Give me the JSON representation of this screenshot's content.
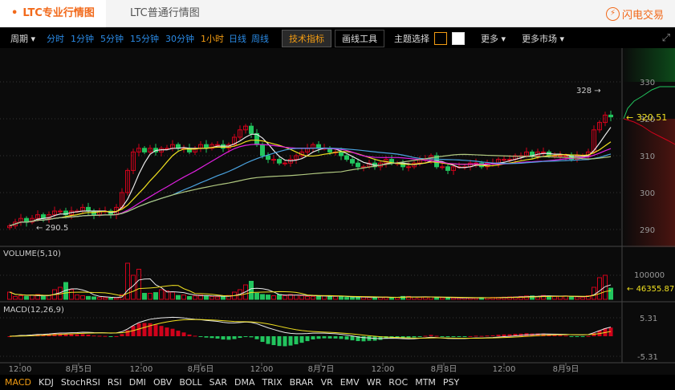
{
  "tabs": {
    "active": "LTC专业行情图",
    "inactive": "LTC普通行情图",
    "trade": "闪电交易",
    "trade_icon": "lightning-icon"
  },
  "toolbar": {
    "period": "周期",
    "intervals": [
      "分时",
      "1分钟",
      "5分钟",
      "15分钟",
      "30分钟",
      "1小时",
      "日线",
      "周线"
    ],
    "active_interval": "1小时",
    "tech": "技术指标",
    "draw": "画线工具",
    "theme": "主题选择",
    "more": "更多",
    "more_markets": "更多市场"
  },
  "colors": {
    "up": "#d0021b",
    "down": "#22c55e",
    "accent": "#f39c12",
    "ma": [
      "#e8e8e8",
      "#f0e020",
      "#e020e0",
      "#4aa3e0",
      "#b0c880"
    ]
  },
  "indicators": [
    "MACD",
    "KDJ",
    "StochRSI",
    "RSI",
    "DMI",
    "OBV",
    "BOLL",
    "SAR",
    "DMA",
    "TRIX",
    "BRAR",
    "VR",
    "EMV",
    "WR",
    "ROC",
    "MTM",
    "PSY"
  ],
  "active_indicator": "MACD",
  "chart_data": {
    "type": "candlestick",
    "price_axis": {
      "ticks": [
        "330",
        "320",
        "310",
        "300",
        "290"
      ],
      "range": [
        285,
        336
      ]
    },
    "last_price": "320.51",
    "high_label": "328",
    "low_label": "290.5",
    "closes": [
      291,
      292,
      293,
      292,
      293,
      294,
      293,
      294,
      295,
      295,
      294,
      295,
      295,
      296,
      295,
      294,
      295,
      295,
      294,
      296,
      300,
      306,
      311,
      312,
      311,
      312,
      311,
      312,
      312,
      313,
      312,
      312,
      311,
      312,
      313,
      312,
      313,
      313,
      312,
      313,
      315,
      317,
      318,
      316,
      313,
      310,
      309,
      309,
      308,
      308,
      309,
      310,
      311,
      312,
      313,
      312,
      312,
      311,
      311,
      310,
      309,
      308,
      307,
      307,
      308,
      307,
      308,
      309,
      308,
      308,
      307,
      307,
      308,
      309,
      309,
      310,
      307,
      307,
      306,
      307,
      307,
      307,
      308,
      308,
      307,
      308,
      308,
      309,
      309,
      309,
      310,
      310,
      311,
      310,
      311,
      311,
      310,
      310,
      310,
      310,
      309,
      310,
      310,
      311,
      317,
      319,
      321,
      320.51
    ],
    "volume": {
      "label": "VOLUME(5,10)",
      "tick": "100000",
      "last": "46355.87",
      "values": [
        30000,
        12000,
        15000,
        12000,
        18000,
        20000,
        12000,
        16000,
        40000,
        50000,
        70000,
        40000,
        18000,
        15000,
        12000,
        10000,
        8000,
        7000,
        6000,
        6000,
        20000,
        150000,
        100000,
        125000,
        25000,
        25000,
        28000,
        40000,
        35000,
        30000,
        16000,
        18000,
        12000,
        14000,
        18000,
        15000,
        12000,
        10000,
        10000,
        16000,
        30000,
        40000,
        60000,
        75000,
        25000,
        20000,
        18000,
        15000,
        20000,
        15000,
        20000,
        18000,
        15000,
        12000,
        12000,
        14000,
        15000,
        13000,
        12000,
        12000,
        8000,
        8000,
        10000,
        9000,
        8000,
        8000,
        8000,
        10000,
        8000,
        8000,
        12000,
        12000,
        10000,
        9000,
        9000,
        10000,
        8000,
        7000,
        6000,
        6000,
        6000,
        7000,
        6000,
        6000,
        7000,
        7000,
        8000,
        8000,
        9000,
        10000,
        10000,
        12000,
        14000,
        14000,
        12000,
        16000,
        14000,
        12000,
        13000,
        14000,
        10000,
        10000,
        9000,
        15000,
        50000,
        90000,
        100000,
        46355
      ]
    },
    "macd": {
      "label": "MACD(12,26,9)",
      "ticks": [
        "5.31",
        "-5.31"
      ]
    },
    "time_labels": [
      "12:00",
      "8月5日",
      "12:00",
      "8月6日",
      "12:00",
      "8月7日",
      "12:00",
      "8月8日",
      "12:00",
      "8月9日"
    ]
  }
}
